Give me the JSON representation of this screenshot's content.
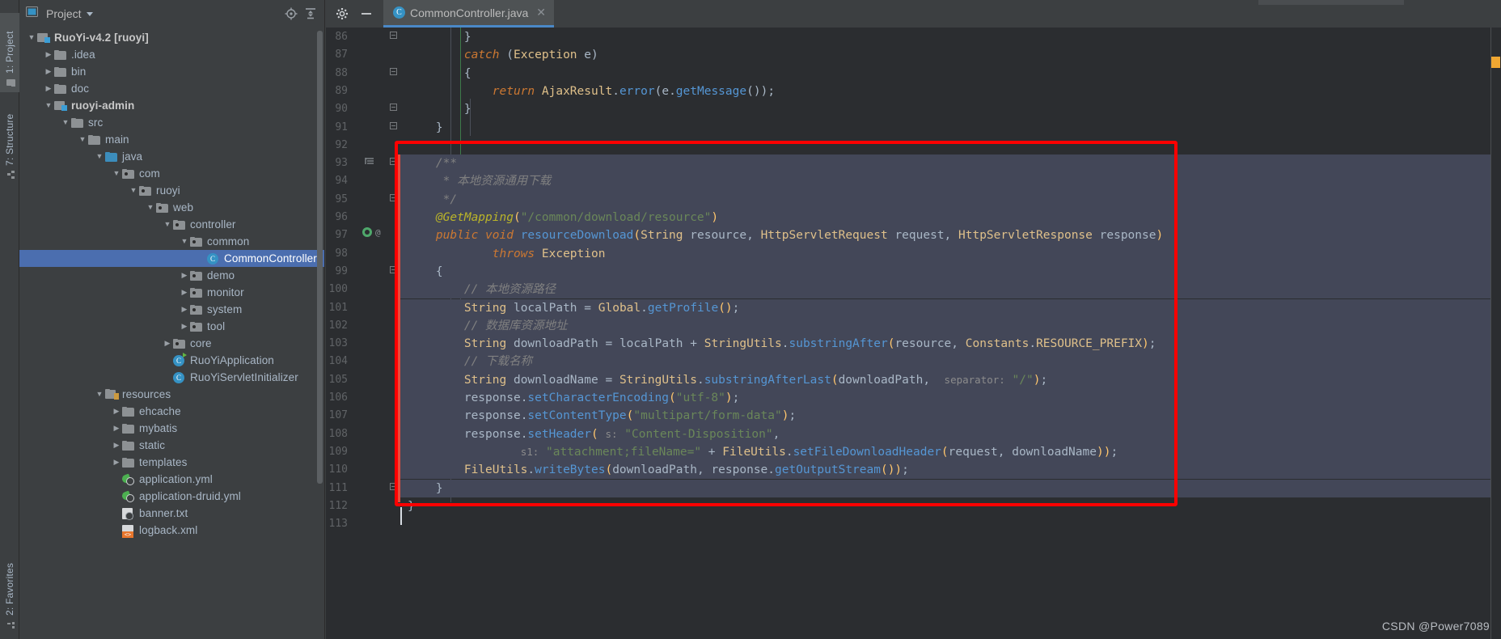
{
  "window": {
    "left_tabs": [
      {
        "label": "1: Project",
        "icon": "project-icon",
        "active": true
      },
      {
        "label": "7: Structure",
        "icon": "structure-icon",
        "active": false
      },
      {
        "label": "2: Favorites",
        "icon": "favorites-icon",
        "active": false
      }
    ]
  },
  "project_panel": {
    "title": "Project",
    "dropdown_icon": "chevron-down-icon",
    "toolbar_icons": [
      "locate-icon",
      "collapse-all-icon",
      "settings-icon",
      "hide-icon"
    ],
    "tree": [
      {
        "label": "RuoYi-v4.2 [ruoyi]",
        "depth": 0,
        "arrow": "down",
        "icon": "module-folder-icon",
        "bold": true
      },
      {
        "label": ".idea",
        "depth": 1,
        "arrow": "right",
        "icon": "folder-icon"
      },
      {
        "label": "bin",
        "depth": 1,
        "arrow": "right",
        "icon": "folder-icon"
      },
      {
        "label": "doc",
        "depth": 1,
        "arrow": "right",
        "icon": "folder-icon"
      },
      {
        "label": "ruoyi-admin",
        "depth": 1,
        "arrow": "down",
        "icon": "module-folder-icon",
        "bold": true
      },
      {
        "label": "src",
        "depth": 2,
        "arrow": "down",
        "icon": "folder-icon"
      },
      {
        "label": "main",
        "depth": 3,
        "arrow": "down",
        "icon": "folder-icon"
      },
      {
        "label": "java",
        "depth": 4,
        "arrow": "down",
        "icon": "source-folder-icon"
      },
      {
        "label": "com",
        "depth": 5,
        "arrow": "down",
        "icon": "package-icon"
      },
      {
        "label": "ruoyi",
        "depth": 6,
        "arrow": "down",
        "icon": "package-icon"
      },
      {
        "label": "web",
        "depth": 7,
        "arrow": "down",
        "icon": "package-icon"
      },
      {
        "label": "controller",
        "depth": 8,
        "arrow": "down",
        "icon": "package-icon"
      },
      {
        "label": "common",
        "depth": 9,
        "arrow": "down",
        "icon": "package-icon"
      },
      {
        "label": "CommonController",
        "depth": 10,
        "arrow": "none",
        "icon": "class-icon",
        "selected": true
      },
      {
        "label": "demo",
        "depth": 9,
        "arrow": "right",
        "icon": "package-icon"
      },
      {
        "label": "monitor",
        "depth": 9,
        "arrow": "right",
        "icon": "package-icon"
      },
      {
        "label": "system",
        "depth": 9,
        "arrow": "right",
        "icon": "package-icon"
      },
      {
        "label": "tool",
        "depth": 9,
        "arrow": "right",
        "icon": "package-icon"
      },
      {
        "label": "core",
        "depth": 8,
        "arrow": "right",
        "icon": "package-icon"
      },
      {
        "label": "RuoYiApplication",
        "depth": 8,
        "arrow": "none",
        "icon": "runnable-class-icon"
      },
      {
        "label": "RuoYiServletInitializer",
        "depth": 8,
        "arrow": "none",
        "icon": "class-icon"
      },
      {
        "label": "resources",
        "depth": 4,
        "arrow": "down",
        "icon": "resources-folder-icon"
      },
      {
        "label": "ehcache",
        "depth": 5,
        "arrow": "right",
        "icon": "folder-icon"
      },
      {
        "label": "mybatis",
        "depth": 5,
        "arrow": "right",
        "icon": "folder-icon"
      },
      {
        "label": "static",
        "depth": 5,
        "arrow": "right",
        "icon": "folder-icon"
      },
      {
        "label": "templates",
        "depth": 5,
        "arrow": "right",
        "icon": "folder-icon"
      },
      {
        "label": "application.yml",
        "depth": 5,
        "arrow": "none",
        "icon": "yml-icon"
      },
      {
        "label": "application-druid.yml",
        "depth": 5,
        "arrow": "none",
        "icon": "yml-icon"
      },
      {
        "label": "banner.txt",
        "depth": 5,
        "arrow": "none",
        "icon": "text-file-icon"
      },
      {
        "label": "logback.xml",
        "depth": 5,
        "arrow": "none",
        "icon": "xml-file-icon"
      }
    ]
  },
  "editor": {
    "tab": {
      "label": "CommonController.java",
      "icon": "java-class-icon",
      "close_icon": "close-icon"
    },
    "first_line_number": 86,
    "lines": [
      {
        "n": 86,
        "fold": "collapse",
        "html": "        <span class='br'>}</span>"
      },
      {
        "n": 87,
        "fold": "",
        "html": "        <span class='kwi'>catch</span> <span class='br'>(</span><span class='typ'>Exception</span> <span class='def'>e</span><span class='br'>)</span>"
      },
      {
        "n": 88,
        "fold": "expand",
        "html": "        <span class='br'>{</span>"
      },
      {
        "n": 89,
        "fold": "",
        "html": "            <span class='kwi'>return</span> <span class='typ'>AjaxResult</span>.<span class='mth'>error</span><span class='br'>(</span><span class='def'>e</span>.<span class='mth'>getMessage</span><span class='br'>())</span>;"
      },
      {
        "n": 90,
        "fold": "collapse",
        "html": "        <span class='br'>}</span>"
      },
      {
        "n": 91,
        "fold": "collapse",
        "html": "    <span class='br'>}</span>"
      },
      {
        "n": 92,
        "fold": "",
        "html": ""
      },
      {
        "n": 93,
        "fold": "collapse",
        "gmark": "doc-mark",
        "html": "    <span class='cmt'>/**</span>",
        "hl": true
      },
      {
        "n": 94,
        "fold": "",
        "html": "     <span class='cmt'>* 本地资源通用下载</span>",
        "hl": true
      },
      {
        "n": 95,
        "fold": "collapse",
        "html": "     <span class='cmt'>*/</span>",
        "hl": true
      },
      {
        "n": 96,
        "fold": "",
        "html": "    <span class='anno'>@GetMapping</span><span class='yel'>(</span><span class='str'>\"/common/download/resource\"</span><span class='yel'>)</span>",
        "hl": true
      },
      {
        "n": 97,
        "fold": "",
        "gmark": "override-mark",
        "html": "    <span class='kwi'>public</span> <span class='kwi'>void</span> <span class='mth'>resourceDownload</span><span class='yel'>(</span><span class='typ'>String</span> <span class='def'>resource</span>, <span class='typ'>HttpServletRequest</span> <span class='def'>request</span>, <span class='typ'>HttpServletResponse</span> <span class='def'>response</span><span class='yel'>)</span>",
        "hl": true
      },
      {
        "n": 98,
        "fold": "",
        "html": "            <span class='purk'>throws</span> <span class='typ'>Exception</span>",
        "hl": true
      },
      {
        "n": 99,
        "fold": "expand",
        "html": "    <span class='br'>{</span>",
        "hl": true
      },
      {
        "n": 100,
        "fold": "",
        "html": "        <span class='cmt'>// 本地资源路径</span>",
        "hl": true
      },
      {
        "n": 101,
        "fold": "",
        "html": "        <span class='typ'>String</span> <span class='def'>localPath</span> <span class='def'>=</span> <span class='typ'>Global</span>.<span class='mth'>getProfile</span><span class='yel'>()</span>;",
        "hl": true
      },
      {
        "n": 102,
        "fold": "",
        "html": "        <span class='cmt'>// 数据库资源地址</span>",
        "hl": true
      },
      {
        "n": 103,
        "fold": "",
        "html": "        <span class='typ'>String</span> <span class='def'>downloadPath</span> <span class='def'>=</span> <span class='def'>localPath</span> + <span class='typ'>StringUtils</span>.<span class='mth'>substringAfter</span><span class='yel'>(</span><span class='def'>resource</span>, <span class='typ'>Constants</span>.<span class='typ'>RESOURCE_PREFIX</span><span class='yel'>)</span>;",
        "hl": true
      },
      {
        "n": 104,
        "fold": "",
        "html": "        <span class='cmt'>// 下载名称</span>",
        "hl": true
      },
      {
        "n": 105,
        "fold": "",
        "html": "        <span class='typ'>String</span> <span class='def'>downloadName</span> <span class='def'>=</span> <span class='typ'>StringUtils</span>.<span class='mth'>substringAfterLast</span><span class='yel'>(</span><span class='def'>downloadPath</span>,  <span class='hint'>separator:</span> <span class='str'>\"/\"</span><span class='yel'>)</span>;",
        "hl": true
      },
      {
        "n": 106,
        "fold": "",
        "html": "        <span class='def'>response</span>.<span class='mth'>setCharacterEncoding</span><span class='yel'>(</span><span class='str'>\"utf-8\"</span><span class='yel'>)</span>;",
        "hl": true
      },
      {
        "n": 107,
        "fold": "",
        "html": "        <span class='def'>response</span>.<span class='mth'>setContentType</span><span class='yel'>(</span><span class='str'>\"multipart/form-data\"</span><span class='yel'>)</span>;",
        "hl": true
      },
      {
        "n": 108,
        "fold": "",
        "html": "        <span class='def'>response</span>.<span class='mth'>setHeader</span><span class='yel'>(</span> <span class='hint'>s:</span> <span class='str'>\"Content-Disposition\"</span>,",
        "hl": true
      },
      {
        "n": 109,
        "fold": "",
        "html": "                <span class='hint'>s1:</span> <span class='str'>\"attachment;fileName=\"</span> + <span class='typ'>FileUtils</span>.<span class='mth'>setFileDownloadHeader</span><span class='yel'>(</span><span class='def'>request</span>, <span class='def'>downloadName</span><span class='yel'>))</span>;",
        "hl": true
      },
      {
        "n": 110,
        "fold": "",
        "html": "        <span class='typ'>FileUtils</span>.<span class='mth'>writeBytes</span><span class='yel'>(</span><span class='def'>downloadPath</span>, <span class='def'>response</span>.<span class='mth'>getOutputStream</span><span class='yel'>())</span>;",
        "hl": true
      },
      {
        "n": 111,
        "fold": "collapse",
        "html": "    <span class='br'>}</span>",
        "hl": true
      },
      {
        "n": 112,
        "fold": "",
        "html": "<span class='br'>}</span>"
      },
      {
        "n": 113,
        "fold": "",
        "html": ""
      }
    ]
  },
  "annotation": {
    "type": "red-rectangle",
    "color": "#ff0000"
  },
  "watermark": {
    "text": "CSDN @Power7089"
  }
}
